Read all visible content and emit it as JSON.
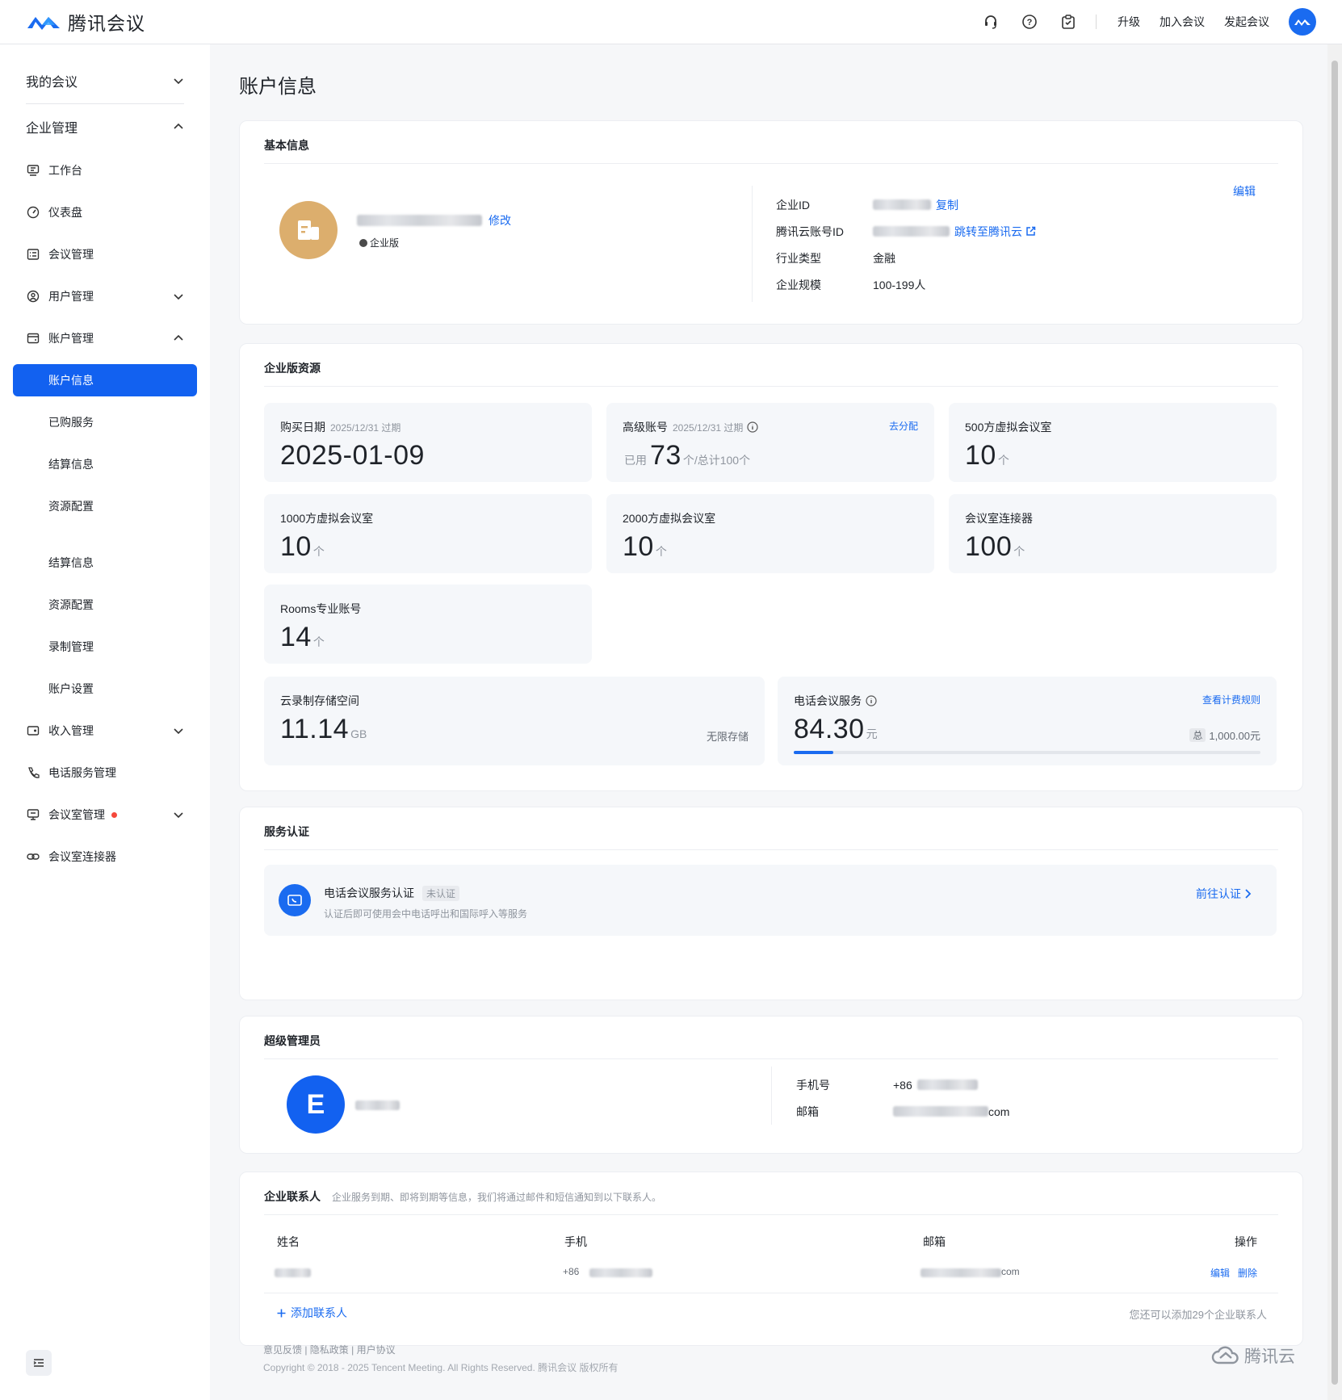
{
  "brand": {
    "name": "腾讯会议",
    "color": "#1a6bf0"
  },
  "topbar": {
    "icons": [
      "headset-icon",
      "help-icon",
      "clipboard-check-icon"
    ],
    "links": {
      "upgrade": "升级",
      "join": "加入会议",
      "start": "发起会议"
    }
  },
  "sidebar": {
    "my_meetings": "我的会议",
    "enterprise": "企业管理",
    "items": {
      "workbench": "工作台",
      "dashboard": "仪表盘",
      "meeting_mgmt": "会议管理",
      "user_mgmt": "用户管理",
      "account_mgmt": "账户管理",
      "income_mgmt": "收入管理",
      "phone_service": "电话服务管理",
      "room_mgmt": "会议室管理",
      "room_connector": "会议室连接器"
    },
    "account_sub": [
      "账户信息",
      "已购服务",
      "结算信息",
      "资源配置"
    ],
    "extra_sub": [
      "结算信息",
      "资源配置",
      "录制管理",
      "账户设置"
    ]
  },
  "page": {
    "title": "账户信息"
  },
  "basic": {
    "title": "基本信息",
    "modify": "修改",
    "edition": "企业版",
    "edit": "编辑",
    "labels": {
      "id": "企业ID",
      "cloud": "腾讯云账号ID",
      "industry": "行业类型",
      "scale": "企业规模"
    },
    "copy": "复制",
    "jump": "跳转至腾讯云",
    "industry": "金融",
    "scale": "100-199人"
  },
  "resources": {
    "title": "企业版资源",
    "purchase": {
      "label": "购买日期",
      "expire": "2025/12/31 过期",
      "value": "2025-01-09"
    },
    "premium": {
      "label": "高级账号",
      "expire": "2025/12/31 过期",
      "action": "去分配",
      "used_label": "已用",
      "used": "73",
      "total": "个/总计100个"
    },
    "tiles": [
      {
        "label": "500方虚拟会议室",
        "value": "10",
        "unit": "个"
      },
      {
        "label": "1000方虚拟会议室",
        "value": "10",
        "unit": "个"
      },
      {
        "label": "2000方虚拟会议室",
        "value": "10",
        "unit": "个"
      },
      {
        "label": "会议室连接器",
        "value": "100",
        "unit": "个"
      },
      {
        "label": "Rooms专业账号",
        "value": "14",
        "unit": "个"
      }
    ],
    "storage": {
      "label": "云录制存储空间",
      "value": "11.14",
      "unit": "GB",
      "note": "无限存储"
    },
    "phone": {
      "label": "电话会议服务",
      "value": "84.30",
      "unit": "元",
      "rule": "查看计费规则",
      "total_tag": "总",
      "total": "1,000.00元",
      "progress": 0.0843
    }
  },
  "cert": {
    "title": "服务认证",
    "name": "电话会议服务认证",
    "status": "未认证",
    "desc": "认证后即可使用会中电话呼出和国际呼入等服务",
    "action": "前往认证"
  },
  "admin": {
    "title": "超级管理员",
    "avatar_letter": "E",
    "labels": {
      "phone": "手机号",
      "email": "邮箱"
    },
    "phone_prefix": "+86",
    "email_suffix": "com"
  },
  "contacts": {
    "title": "企业联系人",
    "subtitle": "企业服务到期、即将到期等信息，我们将通过邮件和短信通知到以下联系人。",
    "columns": [
      "姓名",
      "手机",
      "邮箱",
      "操作"
    ],
    "row": {
      "phone_prefix": "+86",
      "email_suffix": "com",
      "edit": "编辑",
      "delete": "删除"
    },
    "add": "添加联系人",
    "remaining": "您还可以添加29个企业联系人"
  },
  "footer": {
    "links": "意见反馈 | 隐私政策 | 用户协议",
    "copyright": "Copyright © 2018 - 2025 Tencent Meeting. All Rights Reserved. 腾讯会议 版权所有",
    "cloud_brand": "腾讯云"
  }
}
